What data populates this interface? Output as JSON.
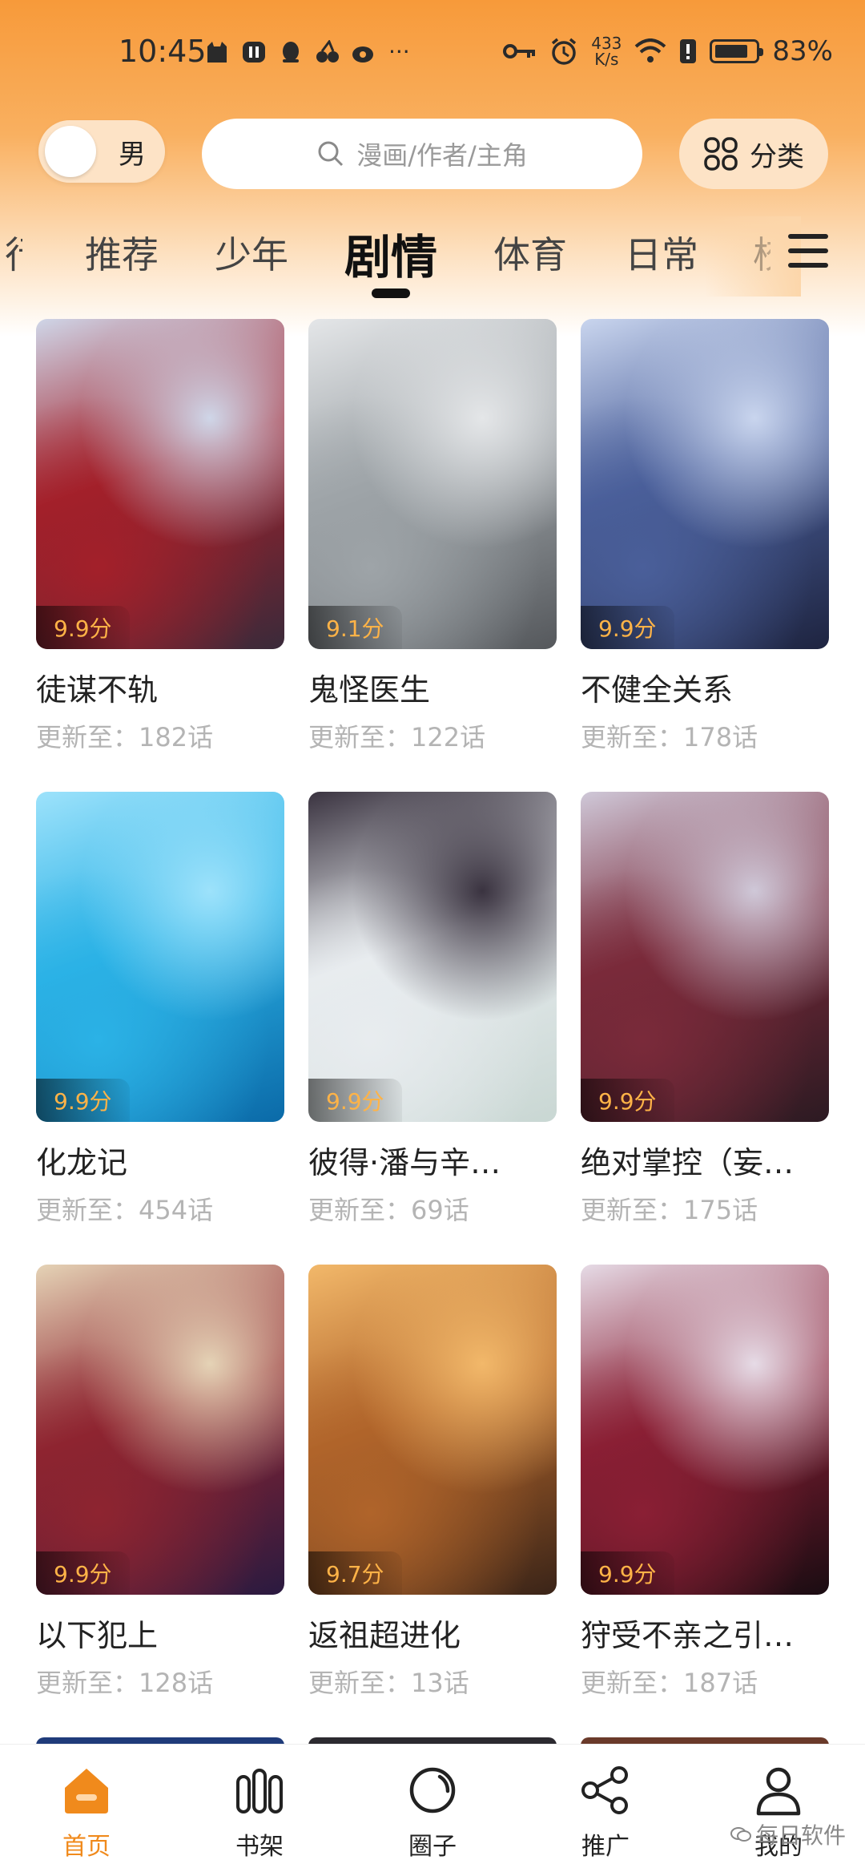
{
  "status_bar": {
    "time": "10:45",
    "net_speed_value": "433",
    "net_speed_unit": "K/s",
    "battery": "83%",
    "battery_level": 0.83
  },
  "header": {
    "gender_label": "男",
    "search_placeholder": "漫画/作者/主角",
    "category_label": "分类"
  },
  "tabs": [
    {
      "label": "行"
    },
    {
      "label": "推荐"
    },
    {
      "label": "少年"
    },
    {
      "label": "剧情",
      "active": true
    },
    {
      "label": "体育"
    },
    {
      "label": "日常"
    },
    {
      "label": "校"
    }
  ],
  "comics": [
    {
      "title": "徒谋不轨",
      "score": "9.9分",
      "update": "更新至：182话",
      "colors": [
        "#3a2a3a",
        "#a3202a",
        "#cfd6e8"
      ]
    },
    {
      "title": "鬼怪医生",
      "score": "9.1分",
      "update": "更新至：122话",
      "colors": [
        "#55585c",
        "#9ea4a8",
        "#e4e6e8"
      ]
    },
    {
      "title": "不健全关系",
      "score": "9.9分",
      "update": "更新至：178话",
      "colors": [
        "#1e2440",
        "#4a5f9a",
        "#c9d5ee"
      ]
    },
    {
      "title": "化龙记",
      "score": "9.9分",
      "update": "更新至：454话",
      "colors": [
        "#0b6aa8",
        "#2bb2e6",
        "#9de2fb"
      ]
    },
    {
      "title": "彼得·潘与辛…",
      "score": "9.9分",
      "update": "更新至：69话",
      "colors": [
        "#c9d7d3",
        "#e8ecef",
        "#3a3340"
      ]
    },
    {
      "title": "绝对掌控（妄…",
      "score": "9.9分",
      "update": "更新至：175话",
      "colors": [
        "#2c1a22",
        "#7a2a3a",
        "#cfc8d8"
      ]
    },
    {
      "title": "以下犯上",
      "score": "9.9分",
      "update": "更新至：128话",
      "colors": [
        "#2a1a40",
        "#8e2430",
        "#e5d3b6"
      ]
    },
    {
      "title": "返祖超进化",
      "score": "9.7分",
      "update": "更新至：13话",
      "colors": [
        "#3a2418",
        "#b0642a",
        "#f2b86a"
      ]
    },
    {
      "title": "狩受不亲之引…",
      "score": "9.9分",
      "update": "更新至：187话",
      "colors": [
        "#1a0c12",
        "#8a1f34",
        "#e6dbe6"
      ]
    }
  ],
  "bottom_nav": [
    {
      "label": "首页",
      "icon": "home-icon",
      "active": true
    },
    {
      "label": "书架",
      "icon": "bookshelf-icon"
    },
    {
      "label": "圈子",
      "icon": "circle-icon"
    },
    {
      "label": "推广",
      "icon": "share-icon"
    },
    {
      "label": "我的",
      "icon": "profile-icon"
    }
  ],
  "watermark": "每日软件",
  "colors": {
    "accent": "#f08a1c",
    "score": "#ffb347"
  }
}
